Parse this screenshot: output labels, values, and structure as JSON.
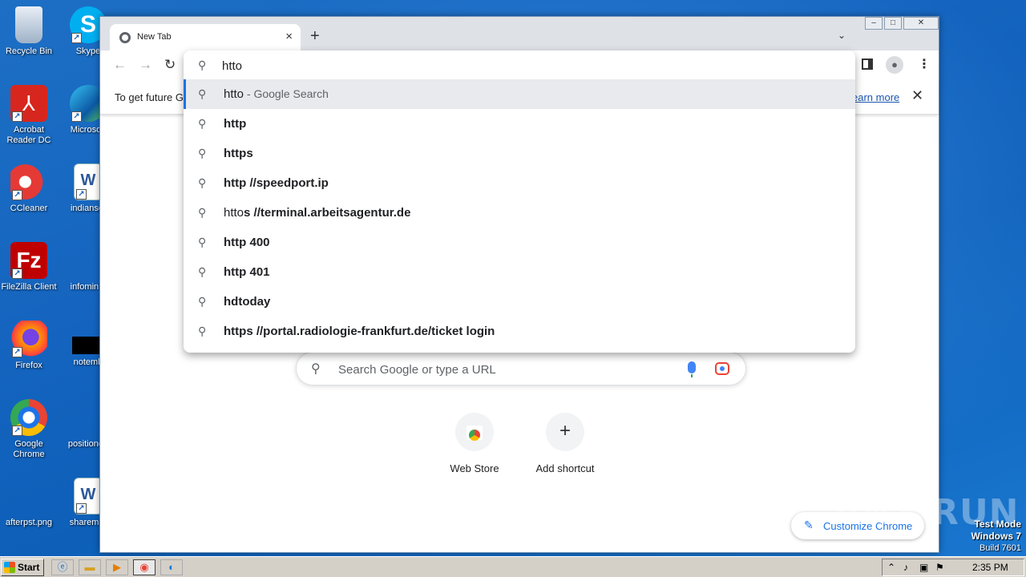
{
  "desktop": {
    "icons": [
      {
        "label": "Recycle Bin",
        "icon": "recycle-bin-icon"
      },
      {
        "label": "Skype",
        "icon": "skype-icon"
      },
      {
        "label": "Acrobat Reader DC",
        "icon": "acrobat-icon"
      },
      {
        "label": "Microsoft",
        "icon": "edge-icon"
      },
      {
        "label": "CCleaner",
        "icon": "ccleaner-icon"
      },
      {
        "label": "indianset",
        "icon": "word-doc-icon"
      },
      {
        "label": "FileZilla Client",
        "icon": "filezilla-icon"
      },
      {
        "label": "infomin.p",
        "icon": "file-icon"
      },
      {
        "label": "Firefox",
        "icon": "firefox-icon"
      },
      {
        "label": "notemb",
        "icon": "file-icon"
      },
      {
        "label": "Google Chrome",
        "icon": "chrome-icon"
      },
      {
        "label": "positionde",
        "icon": "file-icon"
      },
      {
        "label": "afterpst.png",
        "icon": "image-file-icon"
      },
      {
        "label": "sharemar",
        "icon": "word-doc-icon"
      }
    ],
    "watermark": "ANY RUN",
    "test_mode": {
      "line1": "Test Mode",
      "line2": "Windows 7",
      "line3": "Build 7601"
    }
  },
  "browser": {
    "tab_title": "New Tab",
    "tab_close": "×",
    "new_tab": "+",
    "tab_search": "⌄",
    "window_controls": {
      "minimize": "–",
      "maximize": "□",
      "close": "✕"
    },
    "nav": {
      "back": "←",
      "forward": "→",
      "reload": "↻",
      "menu": "⋮"
    },
    "infobar": {
      "text": "To get future G",
      "link": "earn more",
      "close": "✕"
    },
    "omnibox": {
      "value": "htto",
      "suggestions": [
        {
          "typed": "htto",
          "completion": "",
          "suffix": " - Google Search"
        },
        {
          "typed": "",
          "completion": "http",
          "suffix": ""
        },
        {
          "typed": "",
          "completion": "https",
          "suffix": ""
        },
        {
          "typed": "",
          "completion": "http //speedport.ip",
          "suffix": ""
        },
        {
          "typed": "htto",
          "completion": "s //terminal.arbeitsagentur.de",
          "suffix": ""
        },
        {
          "typed": "",
          "completion": "http 400",
          "suffix": ""
        },
        {
          "typed": "",
          "completion": "http 401",
          "suffix": ""
        },
        {
          "typed": "",
          "completion": "hdtoday",
          "suffix": ""
        },
        {
          "typed": "",
          "completion": "https //portal.radiologie-frankfurt.de/ticket login",
          "suffix": ""
        }
      ]
    },
    "ntp": {
      "search_placeholder": "Search Google or type a URL",
      "shortcuts": [
        {
          "label": "Web Store"
        },
        {
          "label": "Add shortcut",
          "glyph": "+"
        }
      ],
      "customize_label": "Customize Chrome"
    }
  },
  "taskbar": {
    "start_label": "Start",
    "clock": "2:35 PM",
    "tray_icons": [
      "chevron-up-icon",
      "speaker-icon",
      "network-icon",
      "flag-icon"
    ]
  }
}
